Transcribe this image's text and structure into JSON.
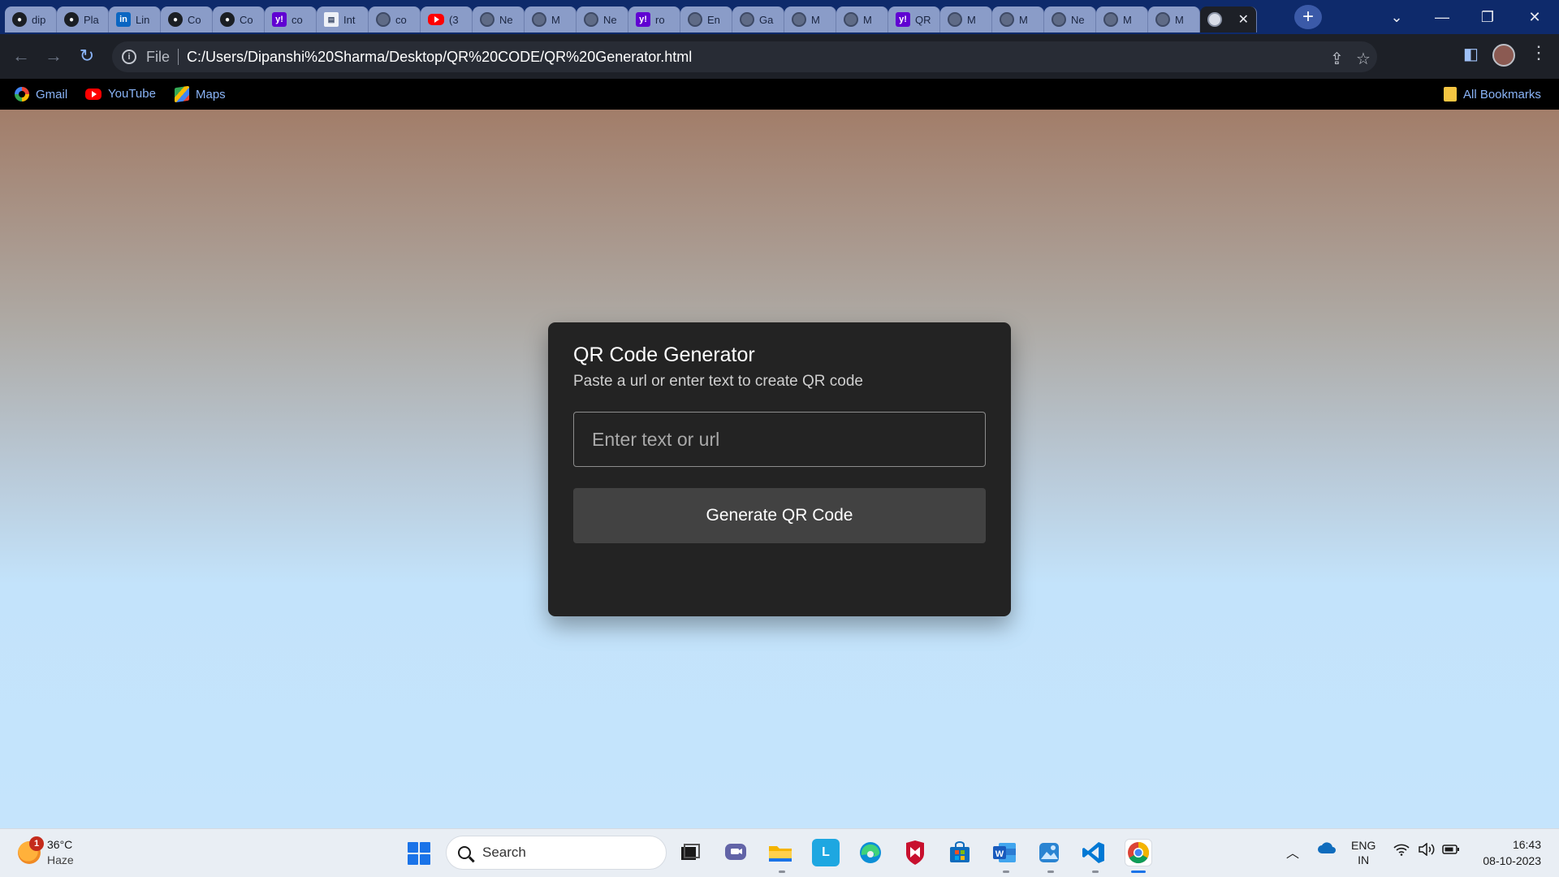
{
  "browser": {
    "tabs": [
      {
        "favicon": "github-icon",
        "label": "dip"
      },
      {
        "favicon": "github-icon",
        "label": "Pla"
      },
      {
        "favicon": "linkedin-icon",
        "label": "Lin"
      },
      {
        "favicon": "github-icon",
        "label": "Co"
      },
      {
        "favicon": "github-icon",
        "label": "Co"
      },
      {
        "favicon": "yahoo-icon",
        "label": "co"
      },
      {
        "favicon": "document-icon",
        "label": "Int"
      },
      {
        "favicon": "globe-icon",
        "label": "co"
      },
      {
        "favicon": "youtube-icon",
        "label": "(3"
      },
      {
        "favicon": "globe-icon",
        "label": "Ne"
      },
      {
        "favicon": "globe-icon",
        "label": "M"
      },
      {
        "favicon": "globe-icon",
        "label": "Ne"
      },
      {
        "favicon": "yahoo-icon",
        "label": "ro"
      },
      {
        "favicon": "globe-icon",
        "label": "En"
      },
      {
        "favicon": "globe-icon",
        "label": "Ga"
      },
      {
        "favicon": "globe-icon",
        "label": "M"
      },
      {
        "favicon": "globe-icon",
        "label": "M"
      },
      {
        "favicon": "yahoo-icon",
        "label": "QR"
      },
      {
        "favicon": "globe-icon",
        "label": "M"
      },
      {
        "favicon": "globe-icon",
        "label": "M"
      },
      {
        "favicon": "globe-icon",
        "label": "Ne"
      },
      {
        "favicon": "globe-icon",
        "label": "M"
      },
      {
        "favicon": "globe-icon",
        "label": "M"
      }
    ],
    "active_tab": {
      "favicon": "globe-icon",
      "close": "✕"
    },
    "new_tab": "+",
    "window_controls": {
      "tabsearch": "⌄",
      "minimize": "—",
      "restore": "❐",
      "close": "✕"
    },
    "address_bar": {
      "scheme": "File",
      "url": "C:/Users/Dipanshi%20Sharma/Desktop/QR%20CODE/QR%20Generator.html"
    },
    "bookmarks": [
      {
        "icon": "google-icon",
        "label": "Gmail"
      },
      {
        "icon": "youtube-icon",
        "label": "YouTube"
      },
      {
        "icon": "maps-icon",
        "label": "Maps"
      }
    ],
    "all_bookmarks": "All Bookmarks"
  },
  "app": {
    "title": "QR Code Generator",
    "subtitle": "Paste a url or enter text to create QR code",
    "input_placeholder": "Enter text or url",
    "input_value": "",
    "button_label": "Generate QR Code"
  },
  "taskbar": {
    "weather": {
      "temp": "36°C",
      "condition": "Haze",
      "badge": "1"
    },
    "search_label": "Search",
    "apps": [
      "task-view-icon",
      "teams-chat-icon",
      "file-explorer-icon",
      "l-app-icon",
      "edge-icon",
      "mcafee-icon",
      "microsoft-store-icon",
      "word-icon",
      "photos-icon",
      "vscode-icon",
      "chrome-icon"
    ],
    "tray": {
      "language_line1": "ENG",
      "language_line2": "IN"
    },
    "clock": {
      "time": "16:43",
      "date": "08-10-2023"
    }
  },
  "colors": {
    "card_bg": "#232323",
    "button_bg": "#424242",
    "tabstrip_bg": "#0e2a6b",
    "link_blue": "#8ab4f8"
  }
}
